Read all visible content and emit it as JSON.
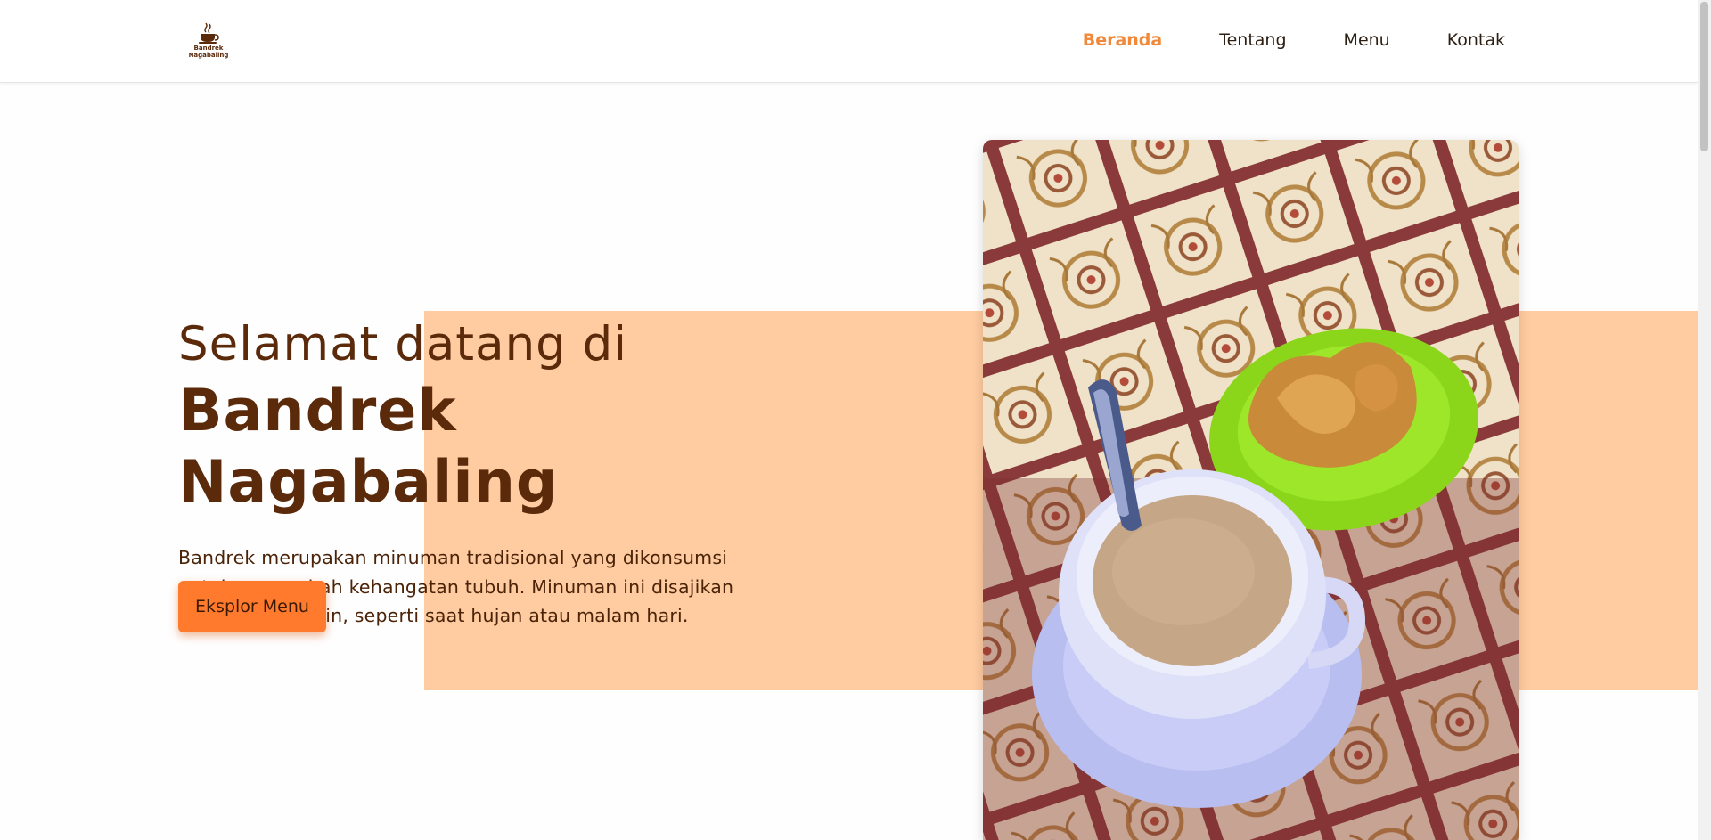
{
  "brand": {
    "logo_text": "Bandrek\nNagabaling",
    "logo_icon": "coffee-cup-icon"
  },
  "nav": {
    "items": [
      {
        "label": "Beranda",
        "active": true
      },
      {
        "label": "Tentang",
        "active": false
      },
      {
        "label": "Menu",
        "active": false
      },
      {
        "label": "Kontak",
        "active": false
      }
    ]
  },
  "hero": {
    "subtitle": "Selamat datang di",
    "title": "Bandrek Nagabaling",
    "description": "Bandrek merupakan minuman tradisional yang dikonsumsi untuk menambah kehangatan tubuh. Minuman ini disajikan saat cuaca dingin, seperti saat hujan atau malam hari.",
    "cta_label": "Eksplor Menu"
  },
  "colors": {
    "accent": "#f08a3a",
    "button": "#ff7a2c",
    "band": "#ffcba0",
    "text_brown": "#5a2a0a"
  }
}
